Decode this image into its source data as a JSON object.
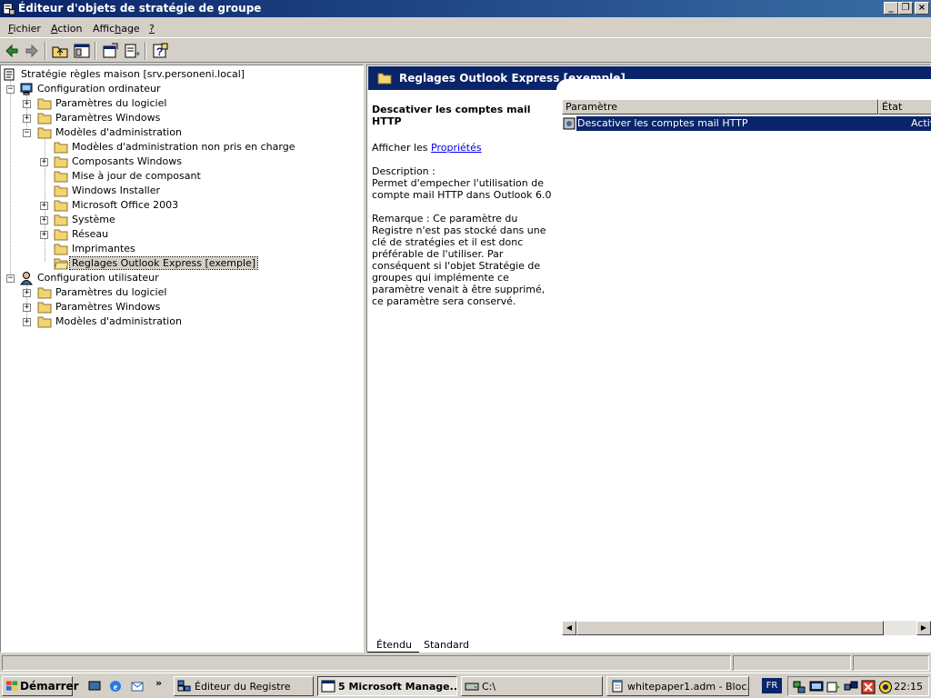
{
  "window": {
    "title": "Éditeur d'objets de stratégie de groupe"
  },
  "window_buttons": {
    "minimize": "_",
    "maximize": "❐",
    "close": "×"
  },
  "menu": {
    "items": [
      {
        "label": "Fichier",
        "underline": "F",
        "rest": "ichier"
      },
      {
        "label": "Action",
        "underline": "A",
        "rest": "ction"
      },
      {
        "label": "Affichage",
        "pre": "Affic",
        "underline": "h",
        "rest": "age"
      },
      {
        "label": "?",
        "underline": "?",
        "rest": ""
      }
    ]
  },
  "tree": {
    "root": "Stratégie règles maison [srv.personeni.local]",
    "computer_config": "Configuration ordinateur",
    "computer_children": {
      "software": "Paramètres du logiciel",
      "windows": "Paramètres Windows",
      "admin": "Modèles d'administration"
    },
    "admin_children": [
      "Modèles d'administration non pris en charge",
      "Composants Windows",
      "Mise à jour de composant",
      "Windows Installer",
      "Microsoft Office 2003",
      "Système",
      "Réseau",
      "Imprimantes",
      "Reglages Outlook Express [exemple]"
    ],
    "user_config": "Configuration utilisateur",
    "user_children": [
      "Paramètres du logiciel",
      "Paramètres Windows",
      "Modèles d'administration"
    ]
  },
  "right": {
    "header": "Reglages Outlook Express [exemple]",
    "desc_title": "Descativer les comptes mail HTTP",
    "show_prefix": "Afficher les ",
    "properties_link": "Propriétés",
    "description_label": "Description :",
    "description_text": "Permet d'empecher l'utilisation de compte mail HTTP dans Outlook 6.0",
    "remark_text": "Remarque : Ce paramètre du Registre n'est pas stocké dans une clé de stratégies et il est donc préférable de l'utiliser. Par conséquent si l'objet Stratégie de groupes qui implémente ce paramètre venait à être supprimé, ce paramètre sera conservé.",
    "columns": {
      "setting": "Paramètre",
      "state": "État"
    },
    "rows": [
      {
        "setting": "Descativer les comptes mail HTTP",
        "state": "Activé"
      }
    ],
    "tabs": {
      "extended": "Étendu",
      "standard": "Standard"
    }
  },
  "taskbar": {
    "start": "Démarrer",
    "chevron": "»",
    "buttons": [
      {
        "label": "Éditeur du Registre"
      },
      {
        "label": "5 Microsoft Manage... ▾"
      },
      {
        "label": "C:\\"
      },
      {
        "label": "whitepaper1.adm - Bloc..."
      }
    ],
    "lang": "FR",
    "clock": "22:15"
  },
  "colors": {
    "title_start": "#0a246a",
    "title_end": "#3a6ea5",
    "selection": "#0a246a",
    "face": "#d4d0c8",
    "folder": "#f2d571"
  }
}
